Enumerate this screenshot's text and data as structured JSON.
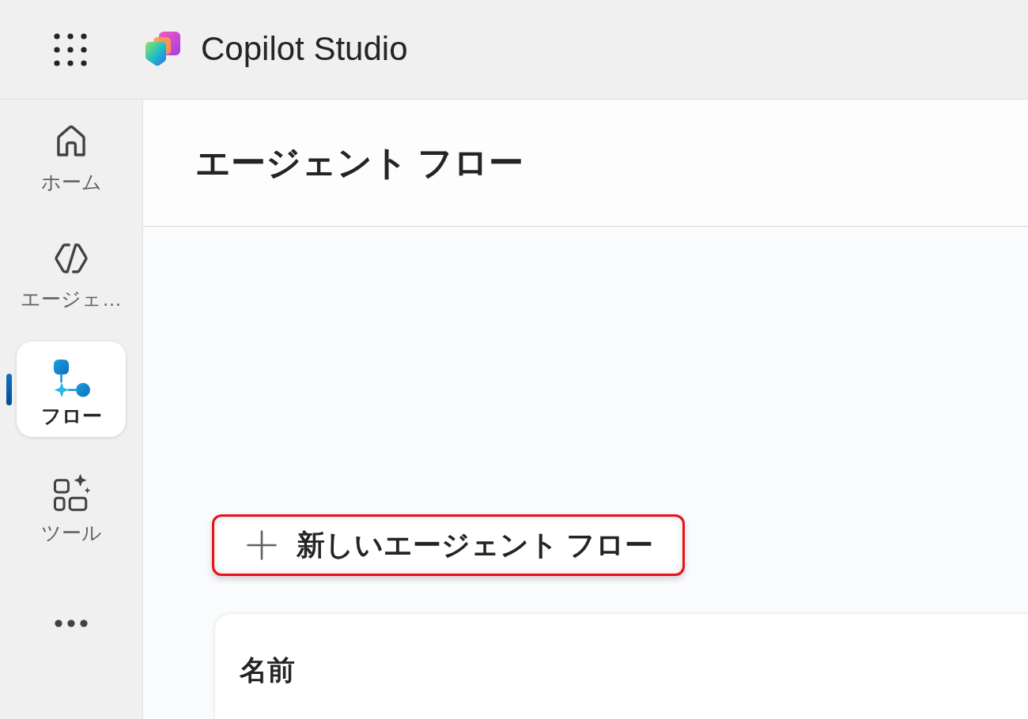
{
  "app": {
    "title": "Copilot Studio"
  },
  "nav": [
    {
      "label": "ホーム",
      "selected": false
    },
    {
      "label": "エージェ…",
      "selected": false
    },
    {
      "label": "フロー",
      "selected": true
    },
    {
      "label": "ツール",
      "selected": false
    }
  ],
  "page": {
    "title": "エージェント フロー"
  },
  "new_button": {
    "label": "新しいエージェント フロー",
    "highlighted": true
  },
  "table": {
    "columns": [
      "名前"
    ]
  }
}
